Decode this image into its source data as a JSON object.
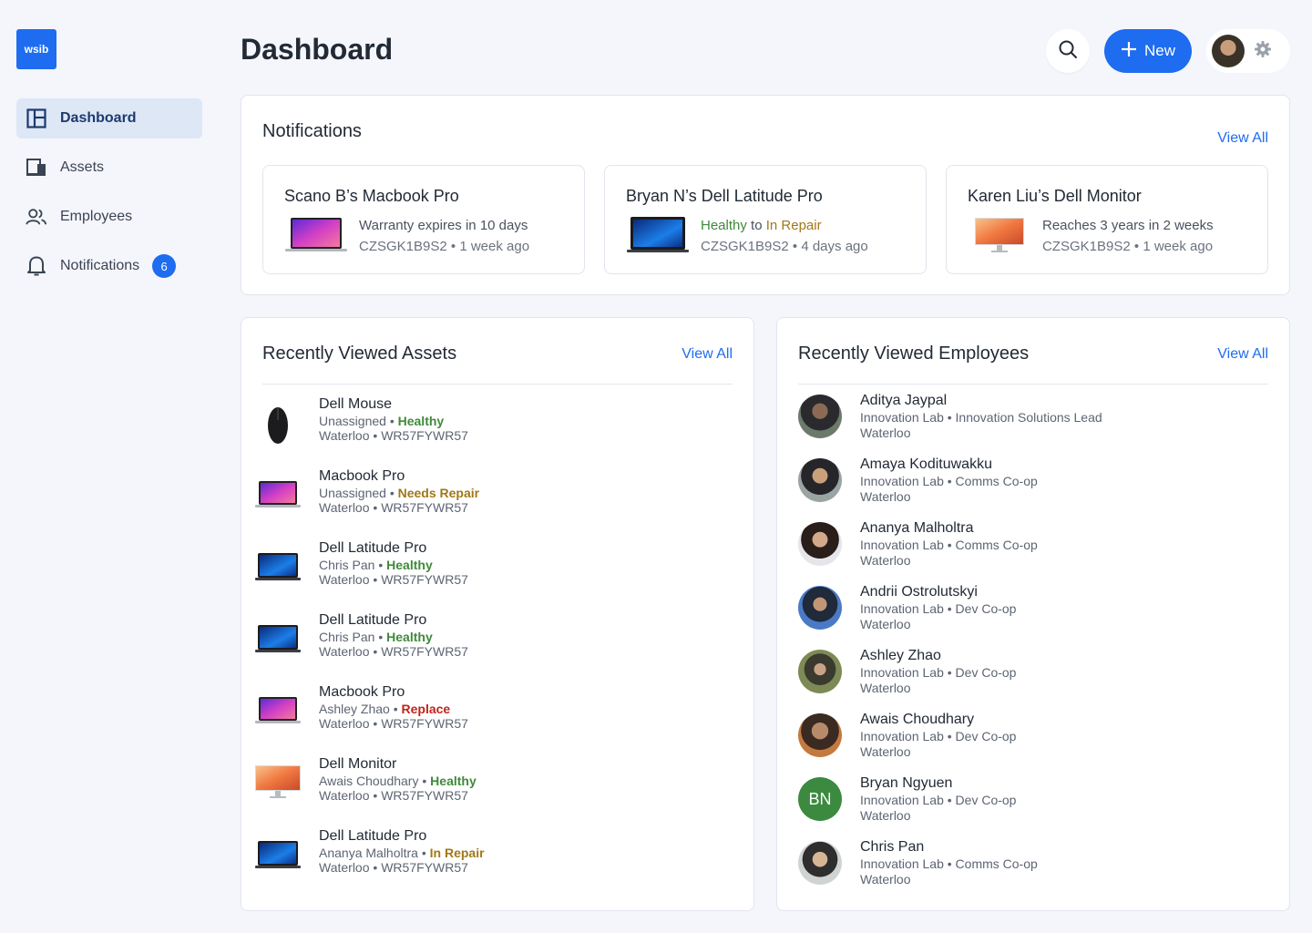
{
  "app": {
    "logo_text": "wsib",
    "page_title": "Dashboard"
  },
  "sidebar": {
    "items": [
      {
        "label": "Dashboard",
        "icon": "dashboard-icon",
        "active": true
      },
      {
        "label": "Assets",
        "icon": "devices-icon"
      },
      {
        "label": "Employees",
        "icon": "people-icon"
      },
      {
        "label": "Notifications",
        "icon": "bell-icon",
        "badge": "6"
      }
    ]
  },
  "header": {
    "new_label": "New"
  },
  "notifications": {
    "title": "Notifications",
    "view_all": "View All",
    "items": [
      {
        "title": "Scano B’s Macbook Pro",
        "thumb": "macbook",
        "line1": "Warranty expires in 10 days",
        "serial": "CZSGK1B9S2",
        "time": "1 week ago"
      },
      {
        "title": "Bryan N’s Dell Latitude Pro",
        "thumb": "dell-laptop",
        "status_from": "Healthy",
        "to_word": "to",
        "status_to": "In Repair",
        "serial": "CZSGK1B9S2",
        "time": "4 days ago"
      },
      {
        "title": "Karen Liu’s Dell Monitor",
        "thumb": "monitor",
        "line1": "Reaches 3 years in 2 weeks",
        "serial": "CZSGK1B9S2",
        "time": "1 week ago"
      }
    ]
  },
  "assets": {
    "title": "Recently Viewed Assets",
    "view_all": "View All",
    "items": [
      {
        "name": "Dell Mouse",
        "owner": "Unassigned",
        "status": "Healthy",
        "status_color": "#3f8a3a",
        "location": "Waterloo",
        "serial": "WR57FYWR57",
        "thumb": "mouse"
      },
      {
        "name": "Macbook Pro",
        "owner": "Unassigned",
        "status": "Needs Repair",
        "status_color": "#a07818",
        "location": "Waterloo",
        "serial": "WR57FYWR57",
        "thumb": "macbook"
      },
      {
        "name": "Dell Latitude Pro",
        "owner": "Chris Pan",
        "status": "Healthy",
        "status_color": "#3f8a3a",
        "location": "Waterloo",
        "serial": "WR57FYWR57",
        "thumb": "dell-laptop"
      },
      {
        "name": "Dell Latitude Pro",
        "owner": "Chris Pan",
        "status": "Healthy",
        "status_color": "#3f8a3a",
        "location": "Waterloo",
        "serial": "WR57FYWR57",
        "thumb": "dell-laptop"
      },
      {
        "name": "Macbook Pro",
        "owner": "Ashley Zhao",
        "status": "Replace",
        "status_color": "#c0241c",
        "location": "Waterloo",
        "serial": "WR57FYWR57",
        "thumb": "macbook"
      },
      {
        "name": "Dell Monitor",
        "owner": "Awais Choudhary",
        "status": "Healthy",
        "status_color": "#3f8a3a",
        "location": "Waterloo",
        "serial": "WR57FYWR57",
        "thumb": "monitor"
      },
      {
        "name": "Dell Latitude Pro",
        "owner": "Ananya Malholtra",
        "status": "In Repair",
        "status_color": "#a07818",
        "location": "Waterloo",
        "serial": "WR57FYWR57",
        "thumb": "dell-laptop"
      }
    ]
  },
  "employees": {
    "title": "Recently Viewed Employees",
    "view_all": "View All",
    "items": [
      {
        "name": "Aditya Jaypal",
        "team": "Innovation Lab",
        "role": "Innovation Solutions Lead",
        "location": "Waterloo"
      },
      {
        "name": "Amaya Kodituwakku",
        "team": "Innovation Lab",
        "role": "Comms Co-op",
        "location": "Waterloo"
      },
      {
        "name": "Ananya Malholtra",
        "team": "Innovation Lab",
        "role": "Comms Co-op",
        "location": "Waterloo"
      },
      {
        "name": "Andrii Ostrolutskyi",
        "team": "Innovation Lab",
        "role": "Dev Co-op",
        "location": "Waterloo"
      },
      {
        "name": "Ashley Zhao",
        "team": "Innovation Lab",
        "role": "Dev Co-op",
        "location": "Waterloo"
      },
      {
        "name": "Awais Choudhary",
        "team": "Innovation Lab",
        "role": "Dev Co-op",
        "location": "Waterloo"
      },
      {
        "name": "Bryan Ngyuen",
        "team": "Innovation Lab",
        "role": "Dev Co-op",
        "location": "Waterloo",
        "initials": "BN"
      },
      {
        "name": "Chris Pan",
        "team": "Innovation Lab",
        "role": "Comms Co-op",
        "location": "Waterloo"
      }
    ]
  },
  "separator": "•"
}
